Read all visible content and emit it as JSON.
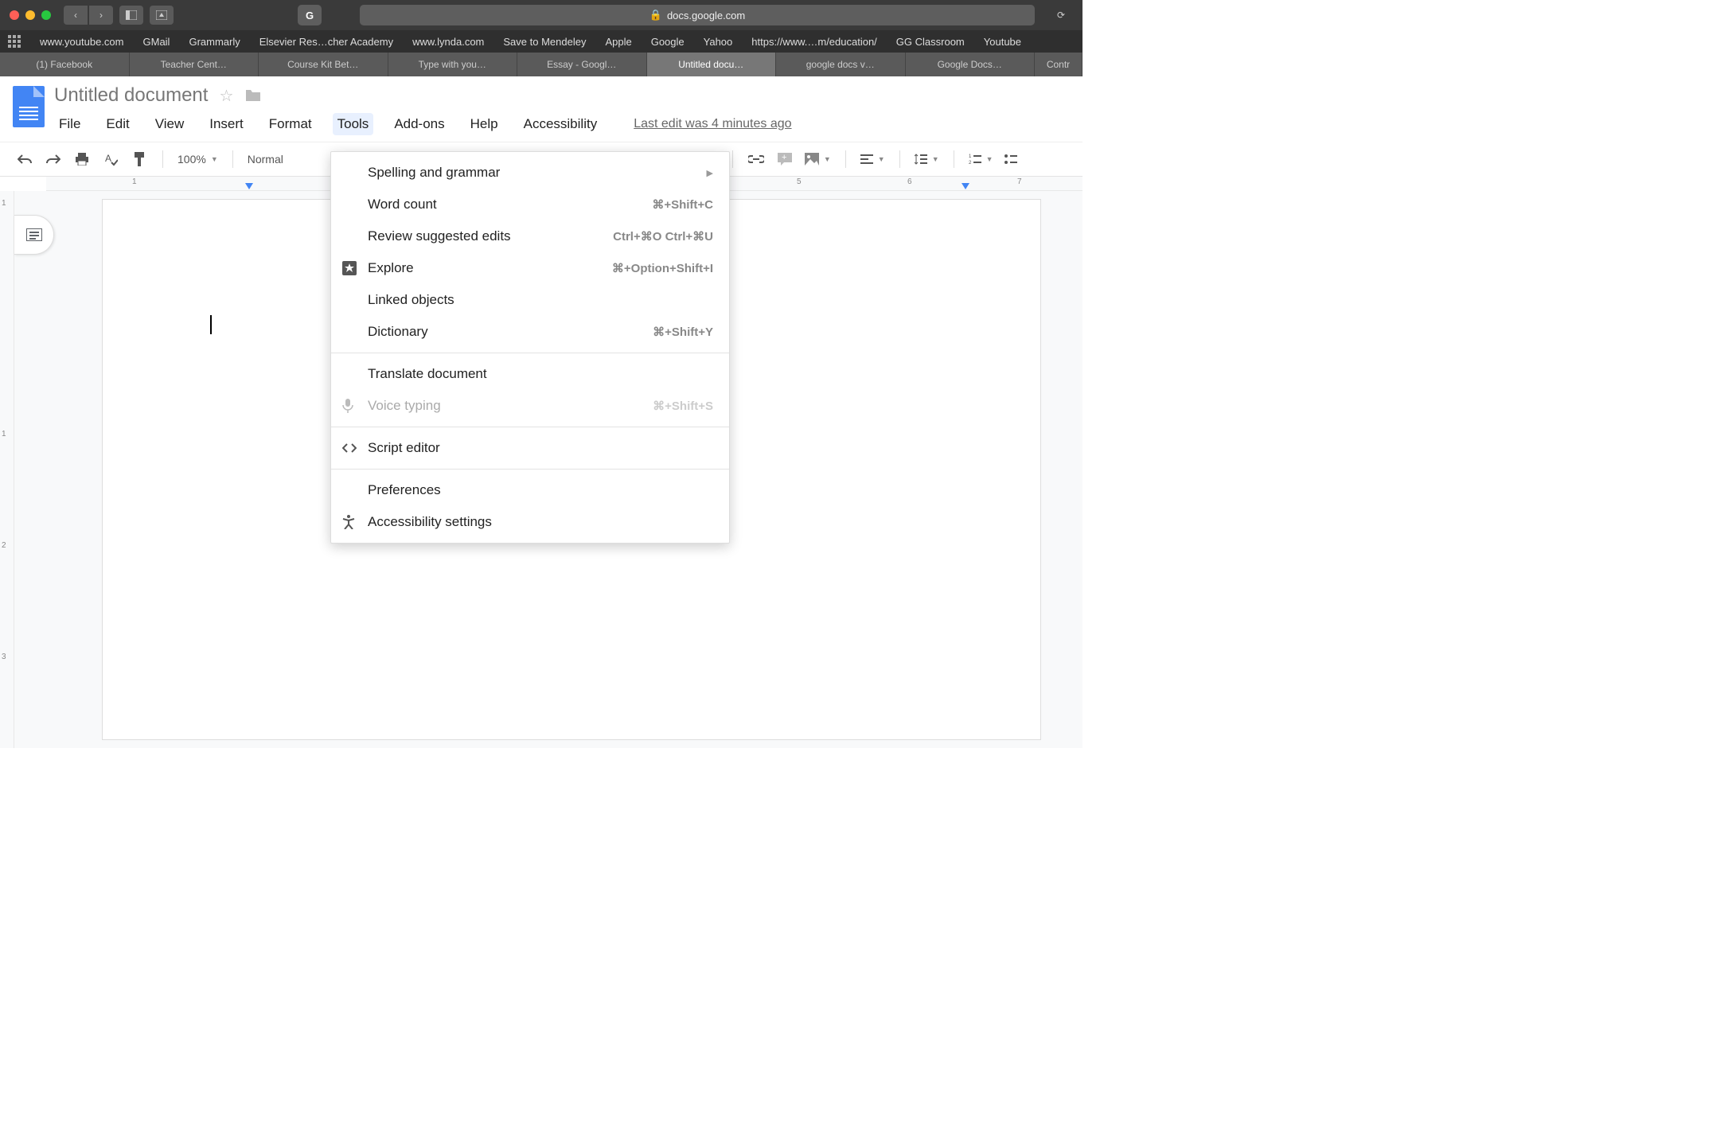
{
  "browser": {
    "url_host": "docs.google.com",
    "bookmarks": [
      "www.youtube.com",
      "GMail",
      "Grammarly",
      "Elsevier Res…cher Academy",
      "www.lynda.com",
      "Save to Mendeley",
      "Apple",
      "Google",
      "Yahoo",
      "https://www.…m/education/",
      "GG Classroom",
      "Youtube"
    ],
    "tabs": [
      {
        "label": "(1) Facebook",
        "active": false
      },
      {
        "label": "Teacher Cent…",
        "active": false
      },
      {
        "label": "Course Kit Bet…",
        "active": false
      },
      {
        "label": "Type with you…",
        "active": false
      },
      {
        "label": "Essay - Googl…",
        "active": false
      },
      {
        "label": "Untitled docu…",
        "active": true
      },
      {
        "label": "google docs v…",
        "active": false
      },
      {
        "label": "Google Docs…",
        "active": false
      },
      {
        "label": "Contr",
        "active": false
      }
    ]
  },
  "doc": {
    "title": "Untitled document",
    "last_edit": "Last edit was 4 minutes ago",
    "menus": [
      "File",
      "Edit",
      "View",
      "Insert",
      "Format",
      "Tools",
      "Add-ons",
      "Help",
      "Accessibility"
    ],
    "open_menu": "Tools"
  },
  "toolbar": {
    "zoom": "100%",
    "style": "Normal"
  },
  "ruler": {
    "h": [
      "1",
      "5",
      "6",
      "7"
    ],
    "v": [
      "1",
      "1",
      "2",
      "3"
    ]
  },
  "tools_menu": [
    {
      "label": "Spelling and grammar",
      "submenu": true
    },
    {
      "label": "Word count",
      "shortcut": "⌘+Shift+C"
    },
    {
      "label": "Review suggested edits",
      "shortcut": "Ctrl+⌘O Ctrl+⌘U"
    },
    {
      "label": "Explore",
      "shortcut": "⌘+Option+Shift+I",
      "icon": "explore"
    },
    {
      "label": "Linked objects"
    },
    {
      "label": "Dictionary",
      "shortcut": "⌘+Shift+Y"
    },
    {
      "sep": true
    },
    {
      "label": "Translate document"
    },
    {
      "label": "Voice typing",
      "shortcut": "⌘+Shift+S",
      "icon": "mic",
      "disabled": true
    },
    {
      "sep": true
    },
    {
      "label": "Script editor",
      "icon": "code"
    },
    {
      "sep": true
    },
    {
      "label": "Preferences"
    },
    {
      "label": "Accessibility settings",
      "icon": "accessibility"
    }
  ]
}
